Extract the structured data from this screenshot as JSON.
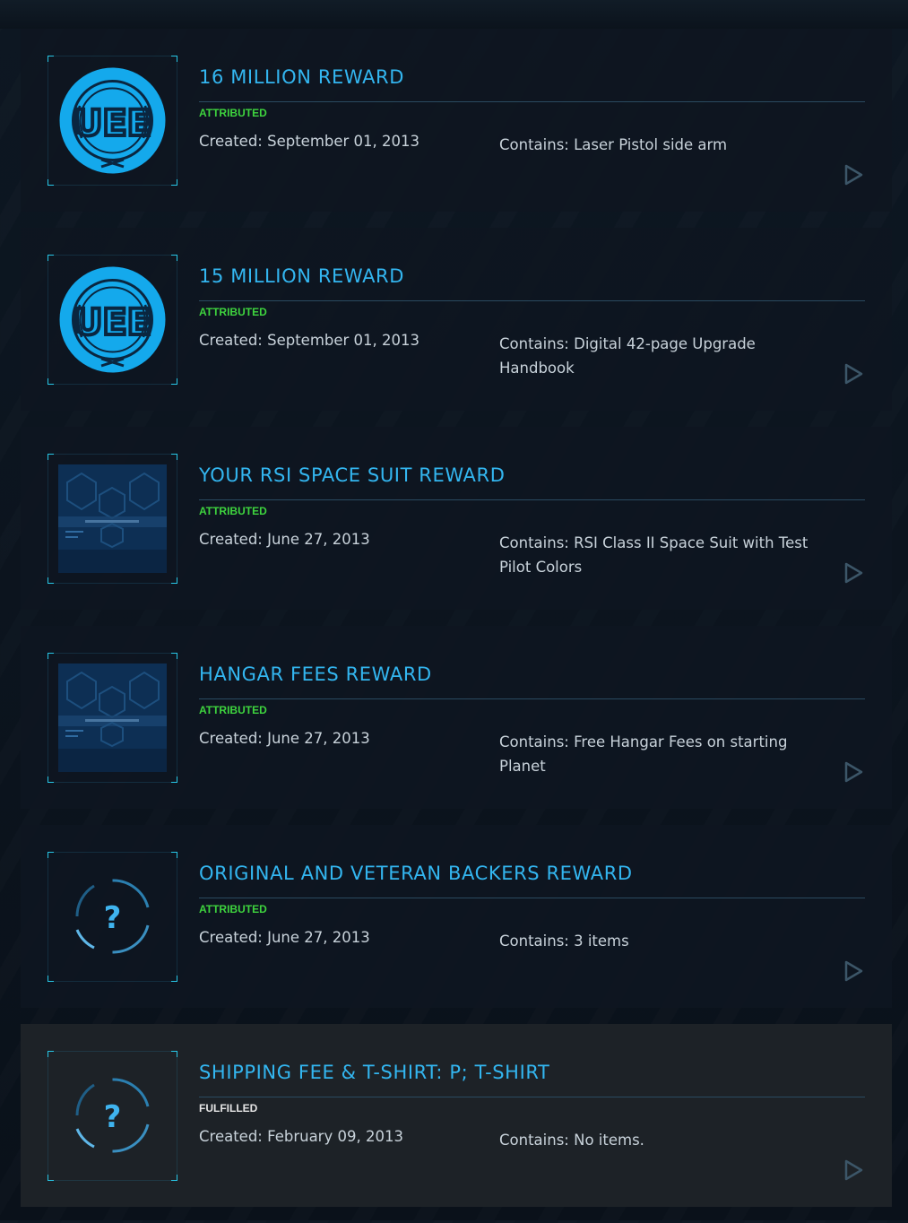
{
  "rewards": [
    {
      "title": "16 MILLION REWARD",
      "status": "ATTRIBUTED",
      "created_label": "Created:",
      "created": "September 01, 2013",
      "contains_label": "Contains:",
      "contains": "Laser Pistol side arm",
      "image": "uee-emblem-icon"
    },
    {
      "title": "15 MILLION REWARD",
      "status": "ATTRIBUTED",
      "created_label": "Created:",
      "created": "September 01, 2013",
      "contains_label": "Contains:",
      "contains": "Digital 42-page Upgrade Handbook",
      "image": "uee-emblem-icon"
    },
    {
      "title": "YOUR RSI SPACE SUIT REWARD",
      "status": "ATTRIBUTED",
      "created_label": "Created:",
      "created": "June 27, 2013",
      "contains_label": "Contains:",
      "contains": "RSI Class II Space Suit with Test Pilot Colors",
      "image": "hangar-thumbnail"
    },
    {
      "title": "HANGAR FEES REWARD",
      "status": "ATTRIBUTED",
      "created_label": "Created:",
      "created": "June 27, 2013",
      "contains_label": "Contains:",
      "contains": "Free Hangar Fees on starting Planet",
      "image": "hangar-thumbnail"
    },
    {
      "title": "ORIGINAL AND VETERAN BACKERS REWARD",
      "status": "ATTRIBUTED",
      "created_label": "Created:",
      "created": "June 27, 2013",
      "contains_label": "Contains:",
      "contains": "3 items",
      "image": "unknown-item-icon"
    },
    {
      "title": "SHIPPING FEE & T-SHIRT: P; T-SHIRT",
      "status": "FULFILLED",
      "created_label": "Created:",
      "created": "February 09, 2013",
      "contains_label": "Contains:",
      "contains": "No items.",
      "image": "unknown-item-icon"
    }
  ],
  "colors": {
    "title": "#33b6f0",
    "attributed": "#3ed43e",
    "fulfilled": "#e4e4e4",
    "text": "#c8d2da",
    "accent": "#28c7e6"
  },
  "icons": {
    "expand": "play-triangle-icon"
  }
}
